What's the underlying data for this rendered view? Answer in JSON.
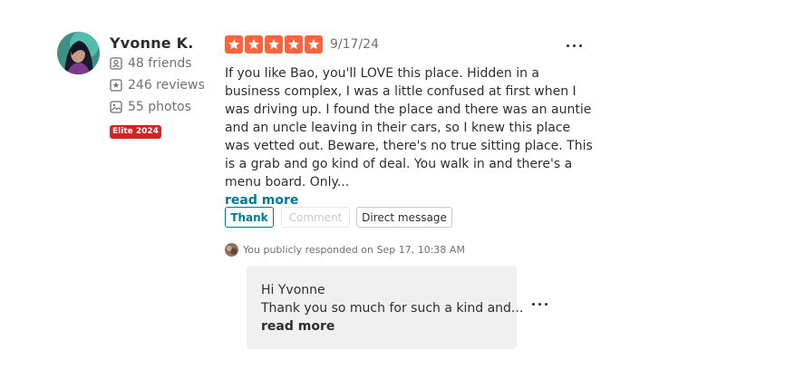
{
  "reviewer": {
    "name": "Yvonne K.",
    "friends": "48 friends",
    "reviews": "246 reviews",
    "photos": "55 photos",
    "elite_badge": "Elite 2024"
  },
  "review": {
    "rating": 5,
    "rating_max": 5,
    "star_color": "#ff643d",
    "date": "9/17/24",
    "text": "If you like Bao, you'll LOVE this place. Hidden in a business complex, I was a little confused at first when I was driving up. I found the place and there was an auntie and an uncle leaving in their cars, so I knew this place was vetted out. Beware, there's no true sitting place. This is a grab and go kind of deal. You walk in and there's a menu board. Only...",
    "read_more": "read more",
    "more_options_icon": "ellipsis-icon"
  },
  "actions": {
    "thank": "Thank",
    "comment": "Comment",
    "direct_message": "Direct message"
  },
  "owner_response": {
    "status": "You publicly responded on Sep 17, 10:38 AM",
    "greeting": "Hi Yvonne",
    "text": "Thank you so much for such a kind and...",
    "read_more": "read more"
  },
  "colors": {
    "accent_link": "#027a97",
    "elite_red": "#d32323",
    "muted_text": "#6e7072",
    "response_bg": "#f0f0f0"
  }
}
